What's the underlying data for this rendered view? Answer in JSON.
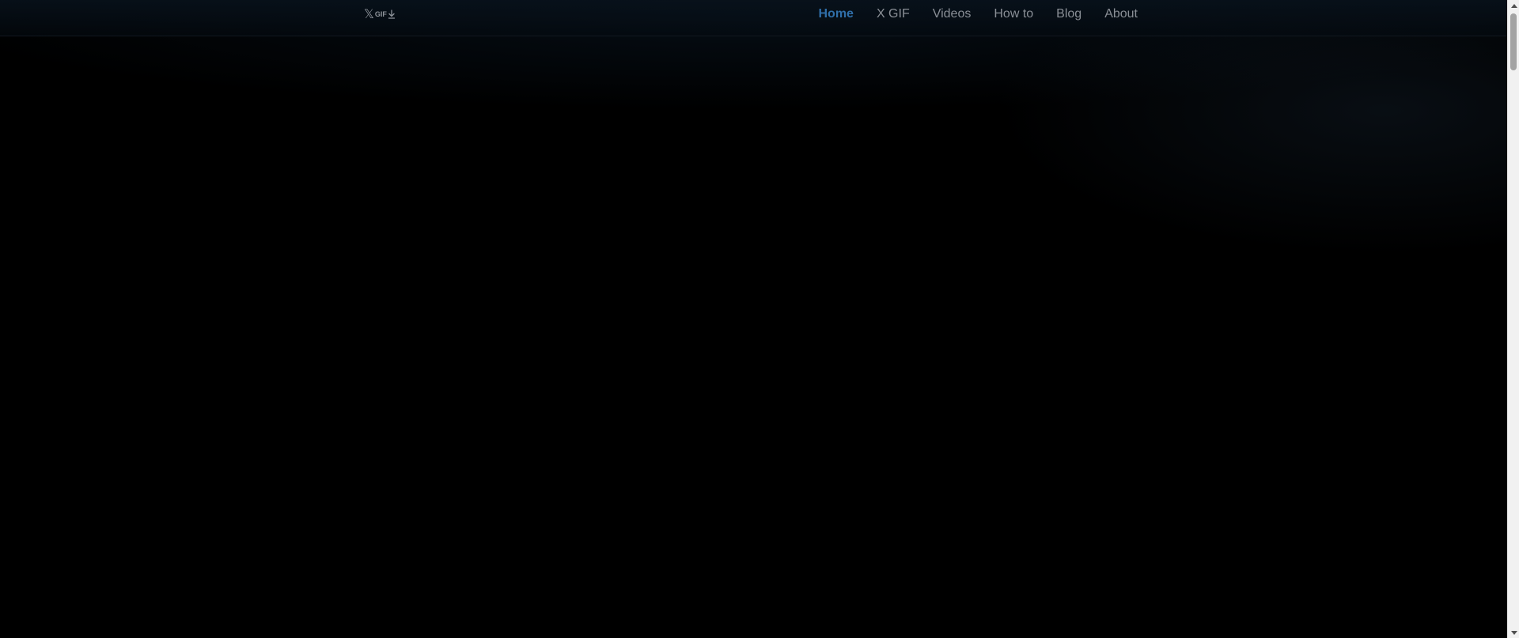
{
  "logo": {
    "text": "GIF",
    "x_icon": "x-brand-icon",
    "arrow_icon": "download-arrow-icon"
  },
  "nav": {
    "items": [
      {
        "label": "Home",
        "active": true
      },
      {
        "label": "X GIF",
        "active": false
      },
      {
        "label": "Videos",
        "active": false
      },
      {
        "label": "How to",
        "active": false
      },
      {
        "label": "Blog",
        "active": false
      },
      {
        "label": "About",
        "active": false
      }
    ]
  },
  "colors": {
    "background": "#000000",
    "nav_text": "#8a8f96",
    "nav_active": "#2f6ea8"
  }
}
